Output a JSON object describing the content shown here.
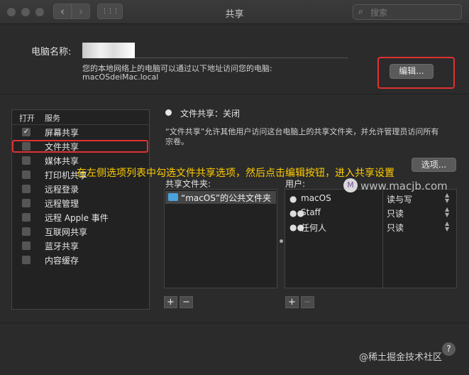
{
  "window": {
    "title": "共享",
    "back": "‹",
    "forward": "›",
    "grid": "⋮⋮⋮",
    "search_placeholder": "搜索"
  },
  "computer": {
    "name_label": "电脑名称:",
    "address_desc": "您的本地网络上的电脑可以通过以下地址访问您的电脑:",
    "address_value": "macOSdeiMac.local",
    "edit_label": "编辑..."
  },
  "services": {
    "header_on": "打开",
    "header_service": "服务",
    "items": [
      {
        "label": "屏幕共享",
        "checked": true,
        "mark": "✓"
      },
      {
        "label": "文件共享",
        "checked": false,
        "mark": ""
      },
      {
        "label": "媒体共享",
        "checked": false,
        "mark": ""
      },
      {
        "label": "打印机共享",
        "checked": false,
        "mark": ""
      },
      {
        "label": "远程登录",
        "checked": false,
        "mark": ""
      },
      {
        "label": "远程管理",
        "checked": false,
        "mark": ""
      },
      {
        "label": "远程 Apple 事件",
        "checked": false,
        "mark": ""
      },
      {
        "label": "互联网共享",
        "checked": false,
        "mark": ""
      },
      {
        "label": "蓝牙共享",
        "checked": false,
        "mark": ""
      },
      {
        "label": "内容缓存",
        "checked": false,
        "mark": ""
      }
    ]
  },
  "status": {
    "text": "文件共享：关闭",
    "desc_line1": "“文件共享”允许其他用户访问这台电脑上的共享文件夹，并允许管理员访问所有",
    "desc_line2": "宗卷。",
    "options_label": "选项..."
  },
  "annotation": "在左侧选项列表中勾选文件共享选项，然后点击编辑按钮，进入共享设置",
  "watermark_site": "www.macjb.com",
  "watermark_logo": "M",
  "folders": {
    "label": "共享文件夹:",
    "items": [
      "“macOS”的公共文件夹"
    ]
  },
  "users": {
    "label": "用户:",
    "items": [
      {
        "name": "macOS",
        "permission": "读与写",
        "icon": "user-icon"
      },
      {
        "name": "Staff",
        "permission": "只读",
        "icon": "group-icon"
      },
      {
        "name": "任何人",
        "permission": "只读",
        "icon": "everyone-icon"
      }
    ]
  },
  "buttons": {
    "add": "+",
    "remove": "−",
    "help": "?"
  },
  "watermark_bottom": "@稀土掘金技术社区"
}
